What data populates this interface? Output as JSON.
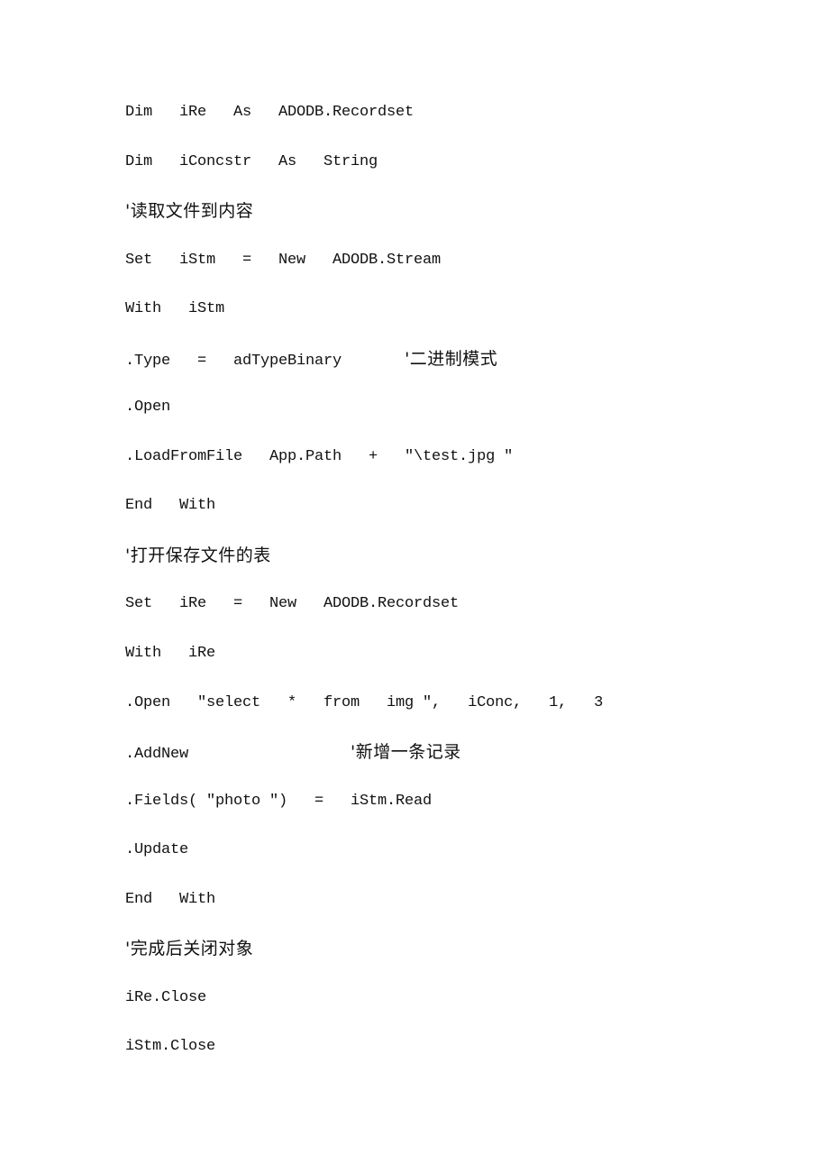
{
  "document": {
    "lines": [
      {
        "code": "Dim   iRe   As   ADODB.Recordset",
        "comment": ""
      },
      {
        "code": "Dim   iConcstr   As   String",
        "comment": ""
      },
      {
        "code": "",
        "comment": "'读取文件到内容"
      },
      {
        "code": "Set   iStm   =   New   ADODB.Stream",
        "comment": ""
      },
      {
        "code": "With   iStm",
        "comment": ""
      },
      {
        "code": ".Type   =   adTypeBinary       ",
        "comment": "'二进制模式"
      },
      {
        "code": ".Open",
        "comment": ""
      },
      {
        "code": ".LoadFromFile   App.Path   +   \"\\test.jpg \"",
        "comment": ""
      },
      {
        "code": "End   With",
        "comment": ""
      },
      {
        "code": "",
        "comment": "'打开保存文件的表"
      },
      {
        "code": "Set   iRe   =   New   ADODB.Recordset",
        "comment": ""
      },
      {
        "code": "With   iRe",
        "comment": ""
      },
      {
        "code": ".Open   \"select   *   from   img \",   iConc,   1,   3",
        "comment": ""
      },
      {
        "code": ".AddNew                  ",
        "comment": "'新增一条记录"
      },
      {
        "code": ".Fields( \"photo \")   =   iStm.Read",
        "comment": ""
      },
      {
        "code": ".Update",
        "comment": ""
      },
      {
        "code": "End   With",
        "comment": ""
      },
      {
        "code": "",
        "comment": "'完成后关闭对象"
      },
      {
        "code": "iRe.Close",
        "comment": ""
      },
      {
        "code": "iStm.Close",
        "comment": ""
      }
    ]
  }
}
